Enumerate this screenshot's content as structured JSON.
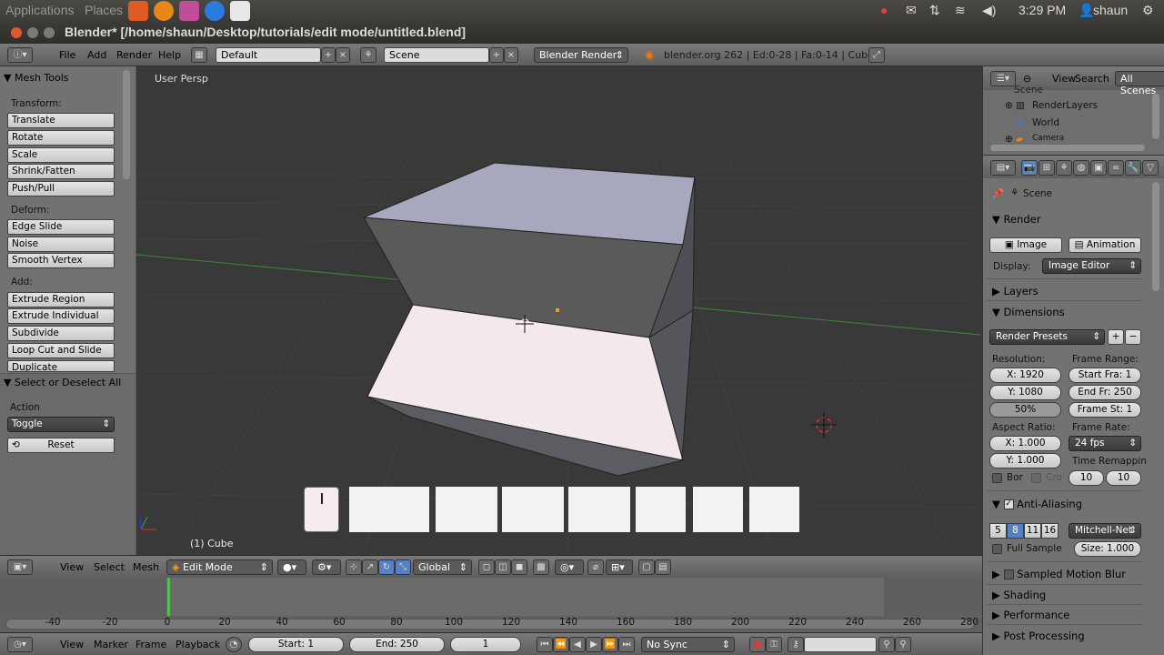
{
  "ubuntu_panel": {
    "menu_applications": "Applications",
    "menu_places": "Places",
    "clock": "3:29 PM",
    "user": "shaun"
  },
  "window": {
    "title": "Blender* [/home/shaun/Desktop/tutorials/edit mode/untitled.blend]"
  },
  "info_header": {
    "menus": [
      "File",
      "Add",
      "Render",
      "Help"
    ],
    "layout": "Default",
    "scene": "Scene",
    "engine": "Blender Render",
    "stats": "blender.org 262 | Ed:0-28 | Fa:0-14 | Cube"
  },
  "toolshelf": {
    "panel_title": "Mesh Tools",
    "transform_label": "Transform:",
    "transform": [
      "Translate",
      "Rotate",
      "Scale",
      "Shrink/Fatten",
      "Push/Pull"
    ],
    "deform_label": "Deform:",
    "deform": [
      "Edge Slide",
      "Noise",
      "Smooth Vertex"
    ],
    "add_label": "Add:",
    "add": [
      "Extrude Region",
      "Extrude Individual",
      "Subdivide",
      "Loop Cut and Slide",
      "Duplicate"
    ],
    "op_panel_title": "Select or Deselect All",
    "action_label": "Action",
    "action_value": "Toggle",
    "reset_label": "Reset"
  },
  "viewport": {
    "view_label": "User Persp",
    "object_label": "(1) Cube"
  },
  "view3d_header": {
    "menus": [
      "View",
      "Select",
      "Mesh"
    ],
    "mode": "Edit Mode",
    "orientation": "Global"
  },
  "timeline": {
    "ticks": [
      "-40",
      "-20",
      "0",
      "20",
      "40",
      "60",
      "80",
      "100",
      "120",
      "140",
      "160",
      "180",
      "200",
      "220",
      "240",
      "260",
      "280"
    ],
    "menus": [
      "View",
      "Marker",
      "Frame",
      "Playback"
    ],
    "start": "Start: 1",
    "end": "End: 250",
    "current": "1",
    "sync": "No Sync"
  },
  "outliner": {
    "menus": [
      "View",
      "Search"
    ],
    "filter": "All Scenes",
    "items": [
      "Scene",
      "RenderLayers",
      "World",
      "Camera"
    ]
  },
  "properties": {
    "context": "Scene",
    "render_title": "Render",
    "image_btn": "Image",
    "animation_btn": "Animation",
    "display_label": "Display:",
    "display_value": "Image Editor",
    "layers_title": "Layers",
    "dimensions_title": "Dimensions",
    "render_presets": "Render Presets",
    "resolution_label": "Resolution:",
    "res_x": "X: 1920",
    "res_y": "Y: 1080",
    "res_pct": "50%",
    "frame_range_label": "Frame Range:",
    "start_fra": "Start Fra: 1",
    "end_fr": "End Fr: 250",
    "frame_st": "Frame St: 1",
    "aspect_label": "Aspect Ratio:",
    "aspect_x": "X: 1.000",
    "aspect_y": "Y: 1.000",
    "frame_rate_label": "Frame Rate:",
    "fps": "24 fps",
    "time_remap_label": "Time Remappin",
    "remap_old": "10",
    "remap_new": "10",
    "bor_label": "Bor",
    "cro_label": "Cro",
    "aa_title": "Anti-Aliasing",
    "aa_samples": [
      "5",
      "8",
      "11",
      "16"
    ],
    "aa_filter": "Mitchell-Net",
    "full_sample": "Full Sample",
    "size": "Size: 1.000",
    "motion_blur": "Sampled Motion Blur",
    "shading": "Shading",
    "performance": "Performance",
    "post_processing": "Post Processing"
  },
  "colors": {
    "accent_blue": "#5680c2",
    "grid_green": "#3f7a3f",
    "grid_red": "#7a3f3f",
    "timeline_green": "#4ec04e"
  }
}
